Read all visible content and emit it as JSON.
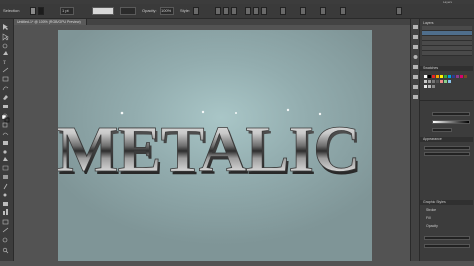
{
  "window": {
    "menu_title": "Layers"
  },
  "options_bar": {
    "selection_label": "Selection",
    "style_label": "Style:",
    "opacity_label": "Opacity:",
    "opacity_value": "100%",
    "field_value": "1 pt"
  },
  "document": {
    "tab_label": "Untitled-1* @ 100% (RGB/GPU Preview)"
  },
  "artwork": {
    "headline": "METALIC"
  },
  "panels": {
    "layers_tab": "Layers",
    "swatches_tab": "Swatches",
    "appearance_tab": "Appearance",
    "graphic_styles_tab": "Graphic Styles",
    "stroke_label": "Stroke",
    "fill_label": "Fill",
    "opacity_label": "Opacity"
  },
  "colors": {
    "ui_dark": "#3c3c3c",
    "ui_mid": "#535353",
    "artboard_center": "#a9c6c7",
    "artboard_edge": "#7f9597"
  }
}
